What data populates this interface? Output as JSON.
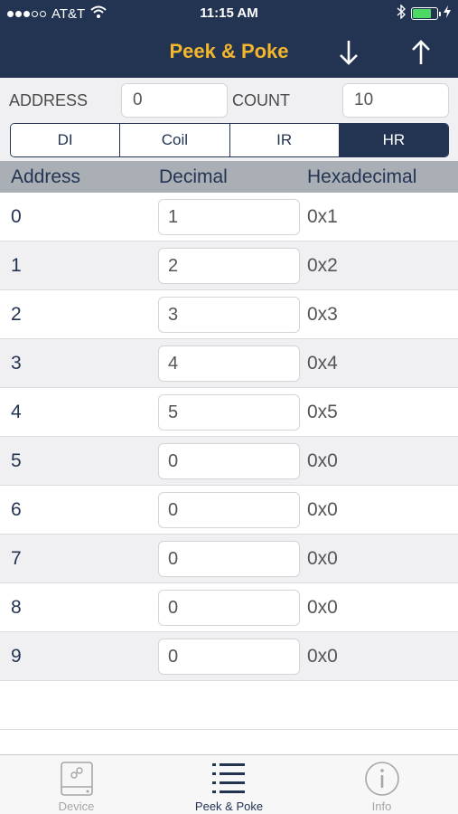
{
  "status_bar": {
    "carrier": "AT&T",
    "time": "11:15 AM",
    "signal_strength": 3,
    "battery_level": 0.75
  },
  "nav": {
    "title": "Peek & Poke",
    "down_icon": "arrow-down-icon",
    "up_icon": "arrow-up-icon"
  },
  "params": {
    "address_label": "ADDRESS",
    "address_value": "0",
    "count_label": "COUNT",
    "count_value": "10"
  },
  "segments": [
    {
      "label": "DI",
      "active": false
    },
    {
      "label": "Coil",
      "active": false
    },
    {
      "label": "IR",
      "active": false
    },
    {
      "label": "HR",
      "active": true
    }
  ],
  "table": {
    "headers": {
      "address": "Address",
      "decimal": "Decimal",
      "hex": "Hexadecimal"
    },
    "rows": [
      {
        "address": "0",
        "decimal": "1",
        "hex": "0x1"
      },
      {
        "address": "1",
        "decimal": "2",
        "hex": "0x2"
      },
      {
        "address": "2",
        "decimal": "3",
        "hex": "0x3"
      },
      {
        "address": "3",
        "decimal": "4",
        "hex": "0x4"
      },
      {
        "address": "4",
        "decimal": "5",
        "hex": "0x5"
      },
      {
        "address": "5",
        "decimal": "0",
        "hex": "0x0"
      },
      {
        "address": "6",
        "decimal": "0",
        "hex": "0x0"
      },
      {
        "address": "7",
        "decimal": "0",
        "hex": "0x0"
      },
      {
        "address": "8",
        "decimal": "0",
        "hex": "0x0"
      },
      {
        "address": "9",
        "decimal": "0",
        "hex": "0x0"
      }
    ]
  },
  "tabbar": {
    "tabs": [
      {
        "label": "Device",
        "icon": "device-icon",
        "active": false
      },
      {
        "label": "Peek & Poke",
        "icon": "list-icon",
        "active": true
      },
      {
        "label": "Info",
        "icon": "info-icon",
        "active": false
      }
    ]
  },
  "colors": {
    "header_bg": "#233453",
    "title": "#f4b72b",
    "accent": "#233453",
    "battery": "#4cd964"
  }
}
